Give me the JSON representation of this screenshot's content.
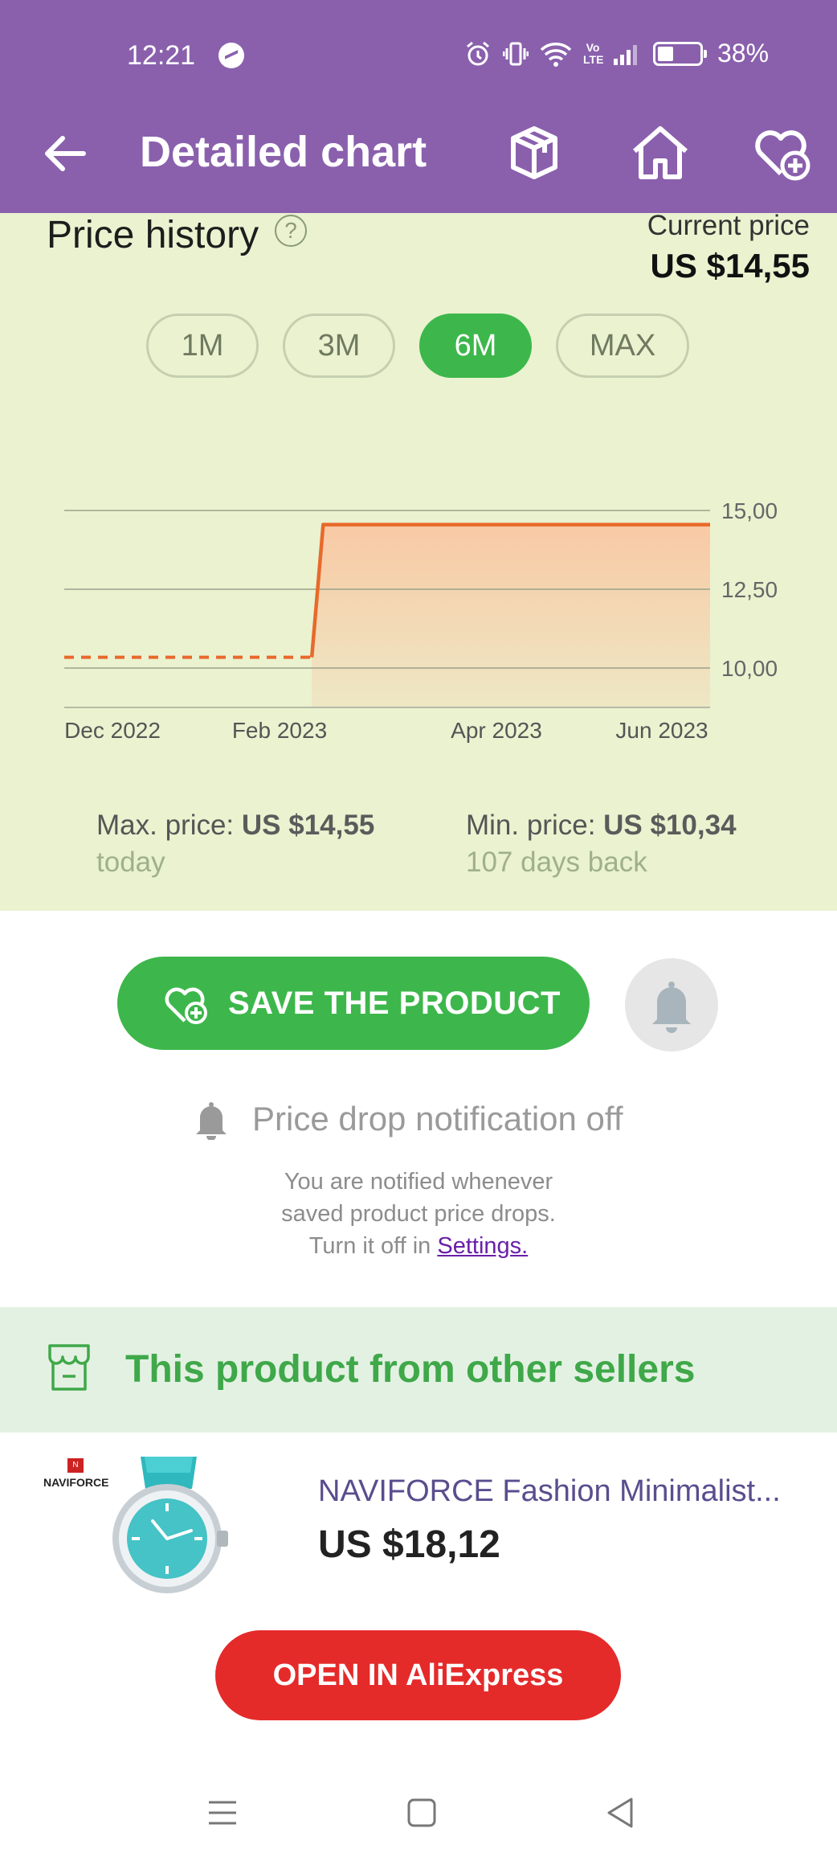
{
  "status_bar": {
    "time": "12:21",
    "battery_pct": "38%",
    "battery_level": 0.38,
    "lte_label": "Vo\nLTE"
  },
  "header": {
    "title": "Detailed chart",
    "icons": [
      "back-arrow-icon",
      "box-icon",
      "home-icon",
      "heart-plus-icon"
    ]
  },
  "price_history": {
    "title": "Price history",
    "help": "?",
    "current_label": "Current price",
    "current_value": "US $14,55",
    "ranges": [
      {
        "label": "1M",
        "active": false
      },
      {
        "label": "3M",
        "active": false
      },
      {
        "label": "6M",
        "active": true
      },
      {
        "label": "MAX",
        "active": false
      }
    ],
    "max_label": "Max. price: ",
    "max_value": "US $14,55",
    "max_when": "today",
    "min_label": "Min. price: ",
    "min_value": "US $10,34",
    "min_when": "107 days back"
  },
  "chart_data": {
    "type": "line",
    "x_ticks": [
      "Dec 2022",
      "Feb 2023",
      "Apr 2023",
      "Jun 2023"
    ],
    "y_ticks": [
      "15,00",
      "12,50",
      "10,00"
    ],
    "ylim": [
      8.75,
      15.0
    ],
    "x_range": [
      "2022-11-15",
      "2023-06-30"
    ],
    "series": [
      {
        "style": "dashed",
        "points": [
          [
            "2022-11-15",
            10.34
          ],
          [
            "2023-02-10",
            10.34
          ]
        ]
      },
      {
        "style": "solid",
        "points": [
          [
            "2023-02-10",
            10.34
          ],
          [
            "2023-02-14",
            14.55
          ],
          [
            "2023-06-30",
            14.55
          ]
        ]
      }
    ],
    "colors": {
      "line": "#e8692b",
      "fill": "#f9c7a2",
      "grid": "#9aa38c"
    },
    "grid": true
  },
  "actions": {
    "save_label": "SAVE THE PRODUCT",
    "notification_status": "Price drop notification off",
    "info_line1": "You are notified whenever",
    "info_line2": "saved product price drops.",
    "info_line3": "Turn it off in ",
    "settings_link": "Settings."
  },
  "other_sellers": {
    "title": "This product from other sellers",
    "brand": "NAVIFORCE",
    "brand_mark": "N",
    "product_name": "NAVIFORCE Fashion Minimalist...",
    "product_price": "US $18,12",
    "open_label": "OPEN IN AliExpress"
  },
  "colors": {
    "header": "#8a60ad",
    "panel": "#eaf2d0",
    "green": "#3db74b",
    "red": "#e52a2a"
  }
}
